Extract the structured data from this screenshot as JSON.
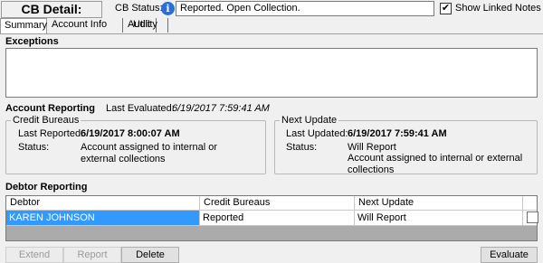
{
  "header": {
    "title": "CB Detail:",
    "cb_status_label": "CB Status:",
    "info_icon": "info-icon",
    "cb_status_value": "Reported. Open Collection.",
    "show_linked_notes_label": "Show Linked Notes",
    "show_linked_notes_checked": true
  },
  "tabs": [
    {
      "label": "Summary",
      "active": true
    },
    {
      "label": "Account Info",
      "active": false
    },
    {
      "label": "Audit",
      "active": false
    },
    {
      "label": "Utility",
      "active": false
    }
  ],
  "exceptions": {
    "title": "Exceptions"
  },
  "account_reporting": {
    "title": "Account Reporting",
    "last_evaluated_label": "Last Evaluated:",
    "last_evaluated_value": "6/19/2017 7:59:41 AM",
    "credit_bureaus": {
      "legend": "Credit Bureaus",
      "last_reported_label": "Last Reported:",
      "last_reported_value": "6/19/2017 8:00:07 AM",
      "status_label": "Status:",
      "status_value": "Account assigned to internal or external collections"
    },
    "next_update": {
      "legend": "Next Update",
      "last_updated_label": "Last Updated:",
      "last_updated_value": "6/19/2017 7:59:41 AM",
      "status_label": "Status:",
      "status_line1": "Will Report",
      "status_line2": "Account assigned to internal or external collections"
    }
  },
  "debtor_reporting": {
    "title": "Debtor Reporting",
    "columns": [
      "Debtor",
      "Credit Bureaus",
      "Next Update"
    ],
    "rows": [
      {
        "debtor": "KAREN JOHNSON",
        "credit_bureaus": "Reported",
        "next_update": "Will Report",
        "selected": true
      }
    ]
  },
  "buttons": {
    "extend": "Extend",
    "report": "Report",
    "delete": "Delete",
    "evaluate": "Evaluate"
  }
}
